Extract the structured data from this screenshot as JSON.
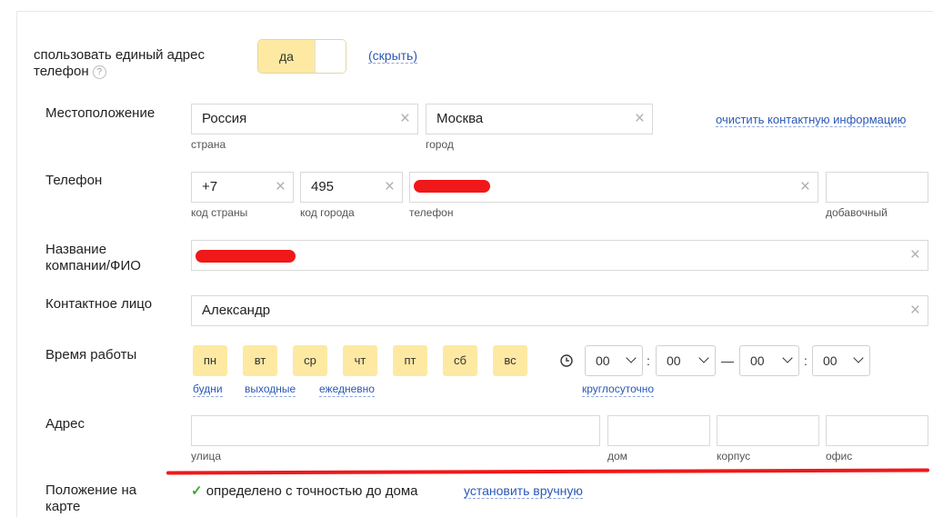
{
  "shared_address": {
    "label_line1": "спользовать единый адрес",
    "label_line2": "телефон",
    "toggle_label": "да",
    "hide_link": "(скрыть)",
    "help_glyph": "?"
  },
  "location": {
    "label": "Местоположение",
    "country_value": "Россия",
    "country_hint": "страна",
    "city_value": "Москва",
    "city_hint": "город",
    "clear_contact_link": "очистить контактную информацию"
  },
  "phone": {
    "label": "Телефон",
    "country_code": "+7",
    "country_code_hint": "код страны",
    "city_code": "495",
    "city_code_hint": "код города",
    "number_hint": "телефон",
    "extension_hint": "добавочный"
  },
  "company": {
    "label_line1": "Название",
    "label_line2": "компании/ФИО"
  },
  "contact_person": {
    "label": "Контактное лицо",
    "value": "Александр"
  },
  "work_hours": {
    "label": "Время работы",
    "days": [
      "пн",
      "вт",
      "ср",
      "чт",
      "пт",
      "сб",
      "вс"
    ],
    "presets": [
      "будни",
      "выходные",
      "ежедневно"
    ],
    "selects": [
      "00",
      "00",
      "00",
      "00"
    ],
    "colon": ":",
    "dash": "—",
    "around_the_clock": "круглосуточно"
  },
  "address": {
    "label": "Адрес",
    "street_hint": "улица",
    "house_hint": "дом",
    "building_hint": "корпус",
    "office_hint": "офис"
  },
  "map_position": {
    "label_line1": "Положение на",
    "label_line2": "карте",
    "status": "определено с точностью до дома",
    "set_manually_link": "установить вручную"
  },
  "colors": {
    "accent_yellow": "#fde9a2",
    "link_blue": "#2a58b6",
    "annotation_red": "#f01818",
    "check_green": "#3aa63a"
  },
  "icons": {
    "clear": "×",
    "clock": "clock-icon",
    "chevron": "chevron-down-icon",
    "check": "✓"
  }
}
